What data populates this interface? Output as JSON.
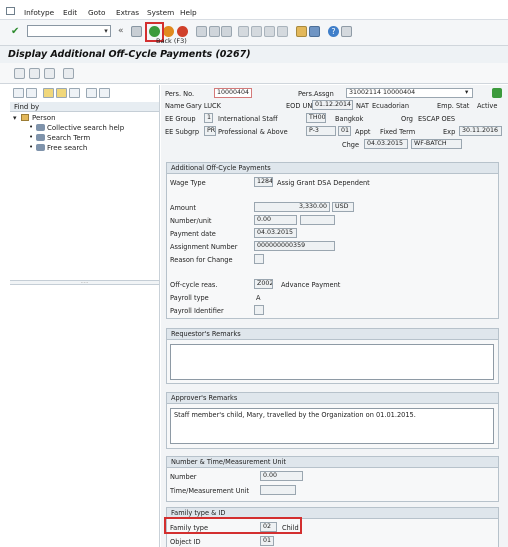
{
  "menu": [
    "Infotype",
    "Edit",
    "Goto",
    "Extras",
    "System",
    "Help"
  ],
  "toolbar": {
    "tooltip": "Back  (F3)"
  },
  "title": "Display Additional Off-Cycle Payments (0267)",
  "left": {
    "find_by": "Find by",
    "person": "Person",
    "items": [
      "Collective search help",
      "Search Term",
      "Free search"
    ]
  },
  "header": {
    "pers_no_label": "Pers. No.",
    "pers_no": "10000404",
    "pers_assgn_label": "Pers.Assgn",
    "pers_assgn": "31002114 10000404",
    "name_label": "Name",
    "name": "Gary LUCK",
    "eod_label": "EOD UN",
    "eod": "01.12.2014",
    "nat_label": "NAT",
    "nat": "Ecuadorian",
    "emp_stat_label": "Emp. Stat",
    "emp_stat": "Active",
    "ee_group_label": "EE Group",
    "ee_group_code": "1",
    "ee_group": "International Staff",
    "th_code": "TH00",
    "location": "Bangkok",
    "org_label": "Org",
    "org": "ESCAP OES",
    "ee_subgrp_label": "EE Subgrp",
    "ee_subgrp_code": "PR",
    "ee_subgrp": "Professional & Above",
    "grade": "P-3",
    "step": "01",
    "appt_label": "Appt",
    "appt": "Fixed Term",
    "exp_label": "Exp",
    "exp": "30.11.2016",
    "chge_label": "Chge",
    "chge_date": "04.03.2015",
    "chge_user": "WF-BATCH"
  },
  "payments": {
    "title": "Additional Off-Cycle Payments",
    "wage_type_label": "Wage Type",
    "wage_type": "1284",
    "wage_type_text": "Assig Grant DSA Dependent",
    "amount_label": "Amount",
    "amount": "3,330.00",
    "currency": "USD",
    "number_label": "Number/unit",
    "number": "0.00",
    "payment_date_label": "Payment date",
    "payment_date": "04.03.2015",
    "assignment_label": "Assignment Number",
    "assignment": "000000000359",
    "reason_label": "Reason for Change",
    "offcycle_label": "Off-cycle reas.",
    "offcycle": "Z002",
    "offcycle_text": "Advance Payment",
    "payroll_type_label": "Payroll type",
    "payroll_type": "A",
    "payroll_id_label": "Payroll Identifier"
  },
  "requestor": {
    "title": "Requestor's Remarks"
  },
  "approver": {
    "title": "Approver's Remarks",
    "text": "Staff member's child, Mary, travelled by the Organization on 01.01.2015."
  },
  "number_time": {
    "title": "Number & Time/Measurement Unit",
    "number_label": "Number",
    "number": "0.00",
    "unit_label": "Time/Measurement Unit"
  },
  "family": {
    "title": "Family type & ID",
    "type_label": "Family type",
    "type_code": "02",
    "type_text": "Child",
    "object_label": "Object ID",
    "object_id": "01"
  },
  "colors": {
    "highlight": "#d32f2f",
    "panel": "#f2f4f6"
  }
}
